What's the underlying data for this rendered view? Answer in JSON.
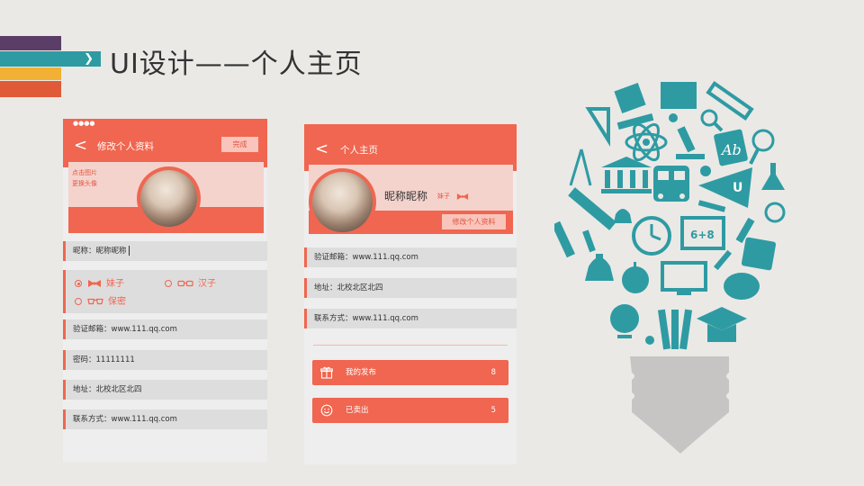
{
  "title": "UI设计——个人主页",
  "colors": {
    "accent": "#f06650",
    "accent_light": "#f5d3cd",
    "teal": "#2e9ba3",
    "purple": "#5a3e68",
    "yellow": "#f2b134",
    "orange": "#e15a38",
    "bulb_base": "#c6c5c4"
  },
  "edit_screen": {
    "status_dots": "●●●●",
    "back_icon": "chevron-left-icon",
    "nav_title": "修改个人资料",
    "done_label": "完成",
    "avatar_hint_line1": "点击图片",
    "avatar_hint_line2": "更换头像",
    "nickname_label": "昵称：昵称昵称",
    "gender": {
      "options": [
        {
          "label": "妹子",
          "selected": true,
          "icon": "bow-icon"
        },
        {
          "label": "汉子",
          "selected": false,
          "icon": "glasses-icon"
        },
        {
          "label": "保密",
          "selected": false,
          "icon": "sunglasses-icon"
        }
      ]
    },
    "email": "验证邮箱：www.111.qq.com",
    "password": "密码：11111111",
    "address": "地址：北校北区北四",
    "contact": "联系方式：www.111.qq.com"
  },
  "profile_screen": {
    "back_icon": "chevron-left-icon",
    "nav_title": "个人主页",
    "nickname": "昵称昵称",
    "tag": "妹子",
    "edit_label": "修改个人资料",
    "email": "验证邮箱：www.111.qq.com",
    "address": "地址：北校北区北四",
    "contact": "联系方式：www.111.qq.com",
    "actions": [
      {
        "icon": "gift-icon",
        "label": "我的发布",
        "count": "8"
      },
      {
        "icon": "smile-icon",
        "label": "已卖出",
        "count": "5"
      }
    ]
  },
  "illustration": {
    "icons": [
      "ruler-icon",
      "notepad-icon",
      "book-icon",
      "pencil-icon",
      "magnifier-icon",
      "set-square-icon",
      "atom-icon",
      "microscope-icon",
      "abc-book-icon",
      "compass-icon",
      "museum-icon",
      "school-bus-icon",
      "pennant-icon",
      "flask-icon",
      "lightbulb-icon",
      "paintbrush-icon",
      "clock-icon",
      "blackboard-icon",
      "test-tube-icon",
      "calculator-icon",
      "bell-icon",
      "apple-icon",
      "computer-icon",
      "palette-icon",
      "globe-icon",
      "pencils-icon",
      "graduation-cap-icon"
    ],
    "flag_text": "U",
    "blackboard_text": "6+8",
    "book_text": "Ab"
  }
}
